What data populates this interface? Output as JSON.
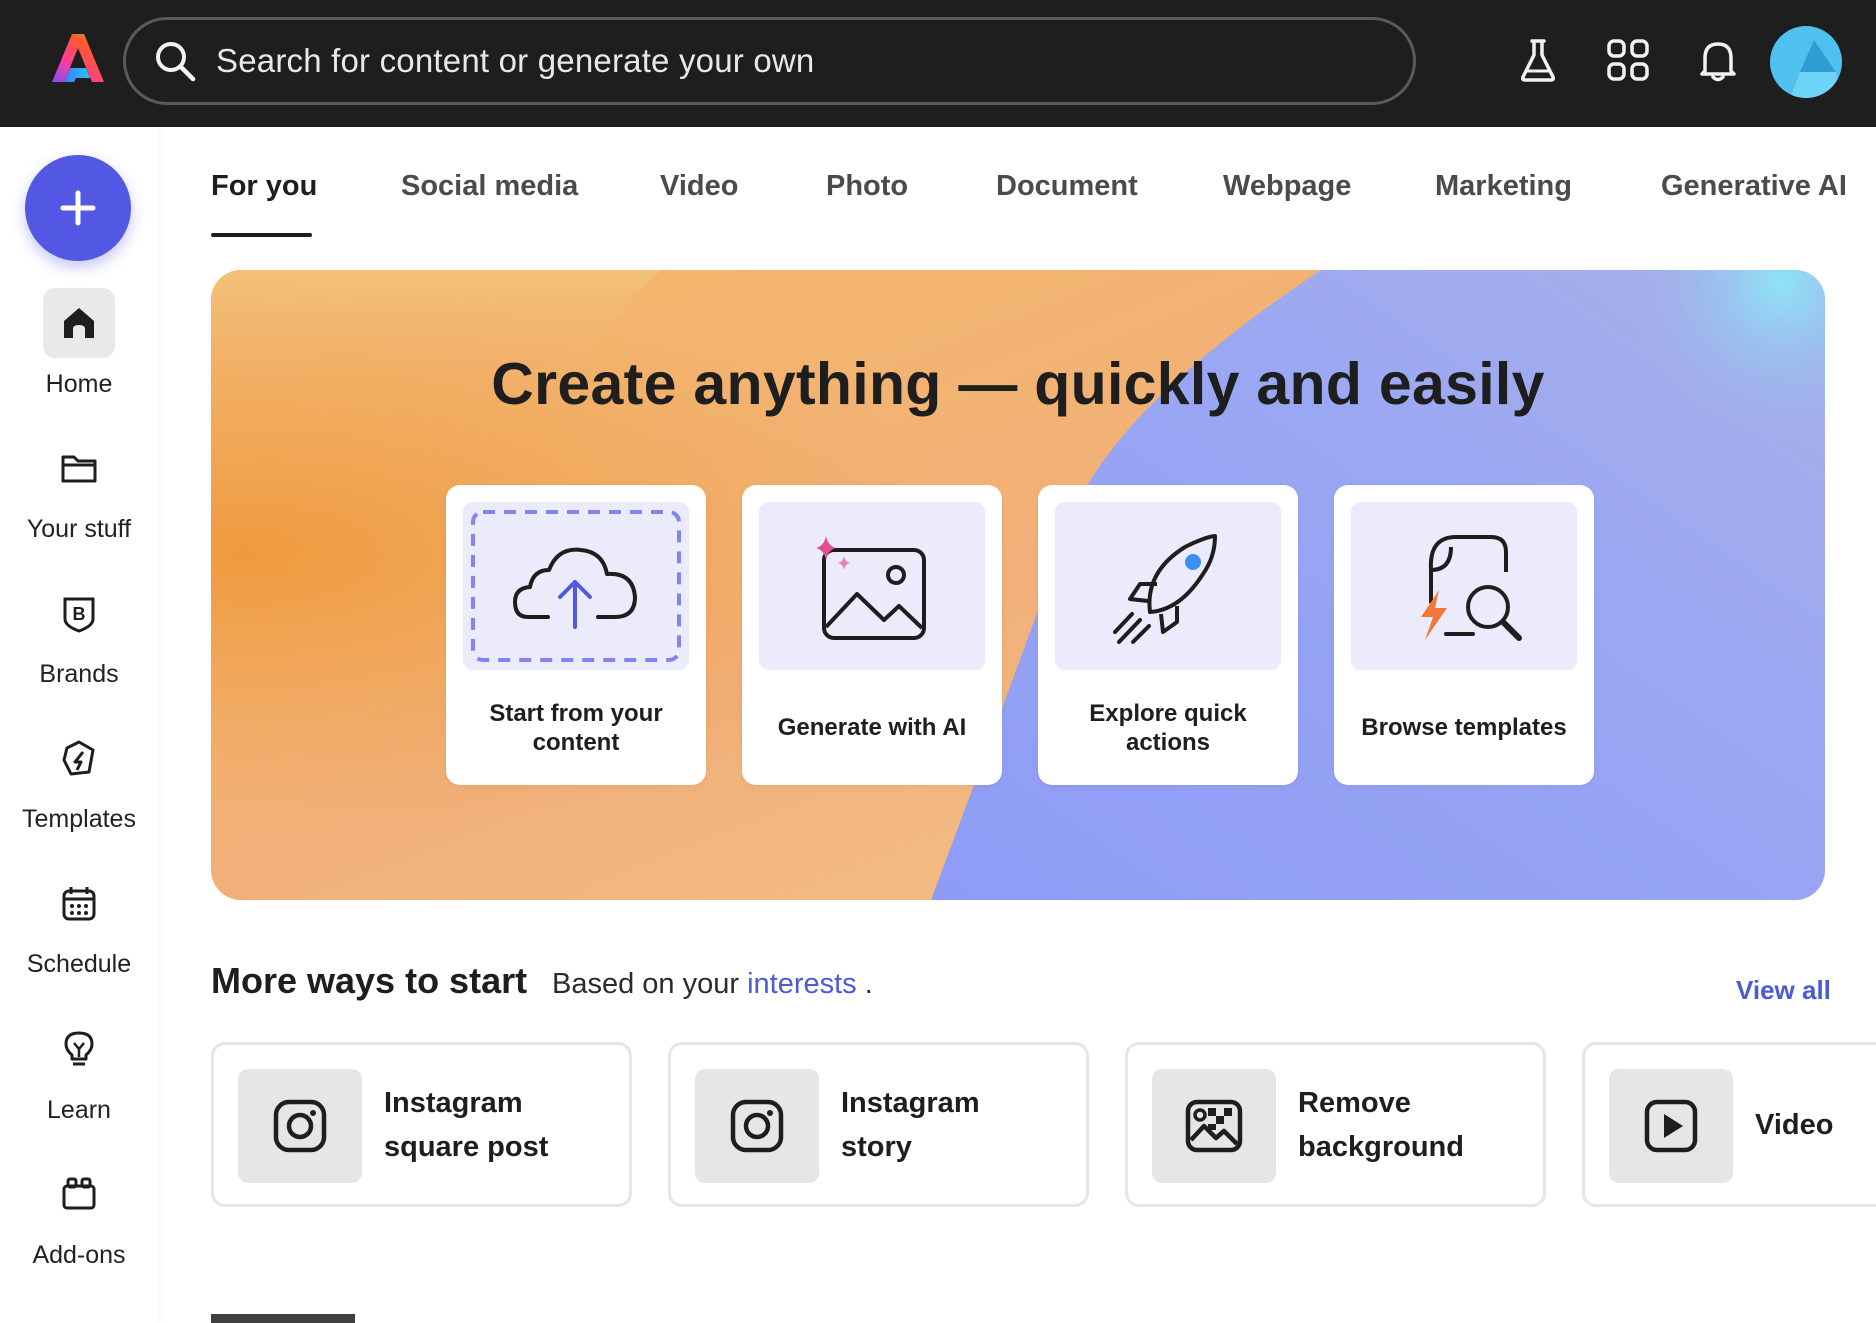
{
  "header": {
    "search": {
      "placeholder": "Search for content or generate your own"
    },
    "icons": [
      "adobe-express-logo",
      "flask-icon",
      "apps-grid-icon",
      "bell-icon",
      "avatar"
    ]
  },
  "sidebar": {
    "create_icon": "plus-icon",
    "items": [
      {
        "label": "Home",
        "icon": "home-icon",
        "active": true
      },
      {
        "label": "Your stuff",
        "icon": "folder-icon"
      },
      {
        "label": "Brands",
        "icon": "brand-icon"
      },
      {
        "label": "Templates",
        "icon": "templates-icon"
      },
      {
        "label": "Schedule",
        "icon": "calendar-icon"
      },
      {
        "label": "Learn",
        "icon": "lightbulb-icon"
      },
      {
        "label": "Add-ons",
        "icon": "addons-icon"
      }
    ]
  },
  "tabs": [
    {
      "label": "For you",
      "active": true
    },
    {
      "label": "Social media"
    },
    {
      "label": "Video"
    },
    {
      "label": "Photo"
    },
    {
      "label": "Document"
    },
    {
      "label": "Webpage"
    },
    {
      "label": "Marketing"
    },
    {
      "label": "Generative AI"
    }
  ],
  "hero": {
    "title": "Create anything — quickly and easily",
    "cards": [
      {
        "label": "Start from your content",
        "icon": "cloud-upload-icon"
      },
      {
        "label": "Generate with AI",
        "icon": "ai-image-icon"
      },
      {
        "label": "Explore quick actions",
        "icon": "rocket-icon"
      },
      {
        "label": "Browse templates",
        "icon": "template-search-icon"
      }
    ]
  },
  "more_ways": {
    "title": "More ways to start",
    "subtitle_prefix": "Based on your",
    "subtitle_link": "interests",
    "subtitle_suffix": ".",
    "view_all": "View all",
    "cards": [
      {
        "label": "Instagram\nsquare post",
        "icon": "instagram-icon"
      },
      {
        "label": "Instagram\nstory",
        "icon": "instagram-icon"
      },
      {
        "label": "Remove\nbackground",
        "icon": "remove-background-icon"
      },
      {
        "label": "Video",
        "icon": "video-play-icon"
      }
    ]
  },
  "colors": {
    "topbar": "#1e1e1e",
    "accent": "#5258e4",
    "link": "#4b5bd6",
    "avatar": "#4fc1ef"
  }
}
